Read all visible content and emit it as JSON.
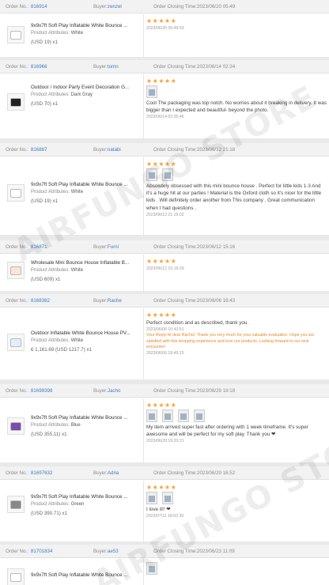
{
  "labels": {
    "order_no": "Order No.:",
    "buyer": "Buyer:",
    "order_closing": "Order Closing Time:",
    "product_attributes": "Product Attributes:",
    "qty_prefix": "x"
  },
  "watermark": "AIRFUNGO STORE",
  "colors": {
    "star": "#f3a33a",
    "link": "#3c7dbf",
    "reply": "#e08a2c"
  },
  "orders": [
    {
      "order_no": "816914",
      "buyer": "zenzel",
      "closing_time": "2023/06/20 05:49",
      "product": "9x9x7ft Soft Play Inflatable White Bounce ...",
      "attribute": "White",
      "price": "(USD  19)",
      "qty": "x1",
      "stars": "★★★★★",
      "review": "",
      "review_date": "2023/06/20 05:49:53",
      "images": 0
    },
    {
      "order_no": "816966",
      "buyer": "tomn",
      "closing_time": "2023/06/14 02:34",
      "product": "Outdoor / Indoor Party Event Decoration G...",
      "attribute": "Dark Gray",
      "price": "(USD  70)",
      "qty": "x1",
      "stars": "★★★★★",
      "review": "Cool The packaging was top notch. No worries about it breaking in delivery. It was bigger than I expected and beautiful- beyond the photo.",
      "review_date": "2023/06/14 02:35:45",
      "images": 1
    },
    {
      "order_no": "816887",
      "buyer": "natabi",
      "closing_time": "2023/06/12 21:18",
      "product": "9x9x7ft Soft Play Inflatable White Bounce ...",
      "attribute": "White",
      "price": "(USD  19)",
      "qty": "x1",
      "stars": "★★★★★",
      "review": "Absolutely obsessed with this mini bounce house . Perfect for little kids 1-3 And it's a huge hit at our parties ! Material is the Oxford cloth so it's nicer for the little kids . Will definitely order another from This company . Great communication when I had questions .",
      "review_date": "2023/06/12 21:19:02",
      "images": 2
    },
    {
      "order_no": "816871",
      "buyer": "Furni",
      "closing_time": "2023/06/12 15:16",
      "product": "Wholesale Mini Bounce House Inflatable B...",
      "attribute": "White",
      "price": "(USD  609)",
      "qty": "x1",
      "stars": "★★★★★",
      "review": "",
      "review_date": "2023/06/12 15:16:29",
      "images": 0
    },
    {
      "order_no": "8168382",
      "buyer": "Rache",
      "closing_time": "2023/06/06 16:43",
      "product": "Outdoor Inflatable White Bounce House PV...",
      "attribute": "White",
      "price": "€ 1,161.69  (USD  1217.7)",
      "qty": "x1",
      "stars": "★★★★★",
      "review": "Perfect condition and as described, thank you.",
      "review_date": "2023/06/06 16:43:51",
      "reply": "Your Reply:Hi dear Rachel, Thank you very much for your valuable evaluation. Hope you are satisfied with this shopping experience and love our products. Looking forward to our next encounter!",
      "reply_date": "2023/06/06 18:49:15",
      "images": 0
    },
    {
      "order_no": "81699398",
      "buyer": "Jacho",
      "closing_time": "2023/06/29 19:18",
      "product": "9x9x7ft Soft Play Inflatable White Bounce ...",
      "attribute": "Blue",
      "price": "(USD  355.11)",
      "qty": "x1",
      "stars": "★★★★★",
      "review": "My item arrived super fast after ordering with 1 week timeframe. It's super awesome and will be perfect for my soft play. Thank you ❤",
      "review_date": "2023/06/29 19:20:21",
      "images": 4
    },
    {
      "order_no": "81697632",
      "buyer": "Adria",
      "closing_time": "2023/06/29 16:52",
      "product": "9x9x7ft Soft Play Inflatable White Bounce ...",
      "attribute": "Green",
      "price": "(USD  390.71)",
      "qty": "x1",
      "stars": "★★★★★",
      "review": "I love it!! ❤",
      "review_date": "2023/07/11 18:02:30",
      "images": 2
    },
    {
      "order_no": "81701834",
      "buyer": "ae53",
      "closing_time": "2023/06/23 11:09",
      "product": "9x9x7ft Soft Play Inflatable White Bounce ...",
      "attribute": "",
      "price": "",
      "qty": "",
      "stars": "",
      "review": "",
      "review_date": "",
      "images": 1
    }
  ]
}
